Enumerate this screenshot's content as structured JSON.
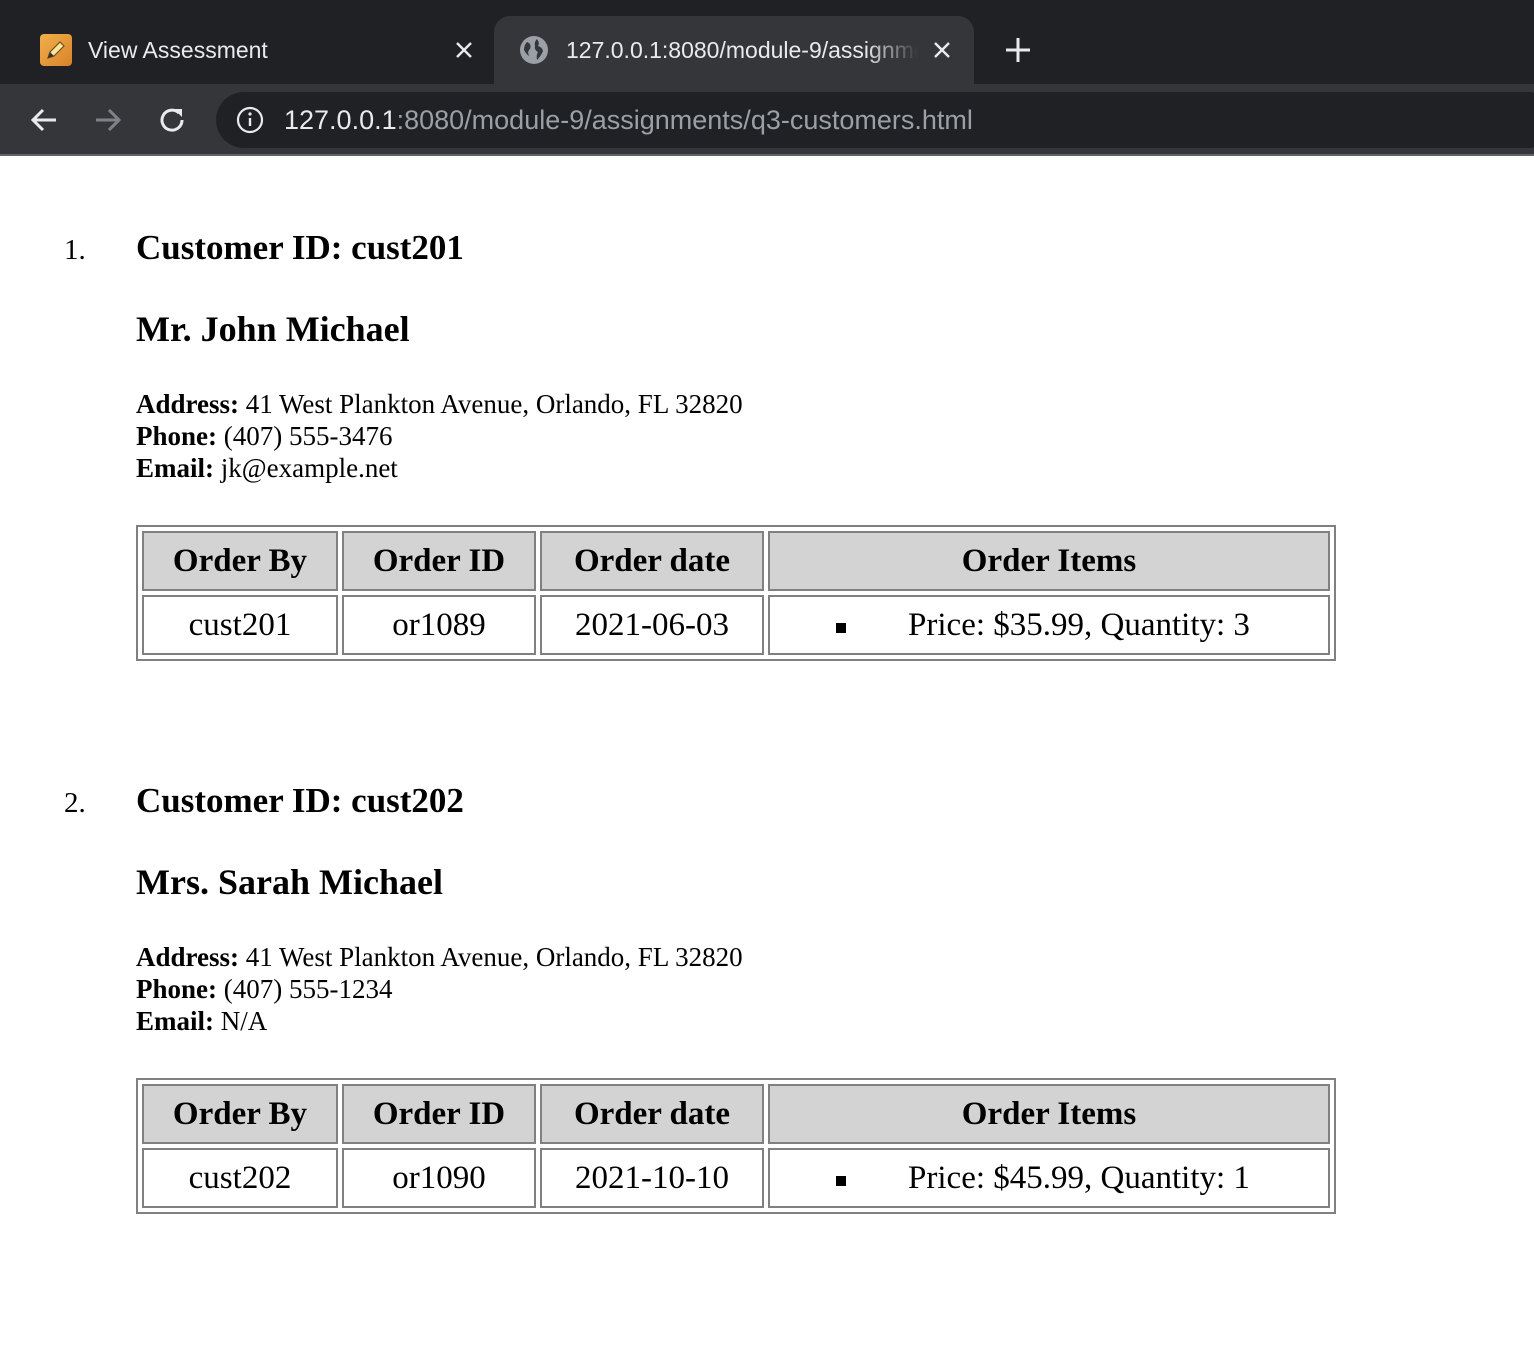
{
  "browser": {
    "tabs": [
      {
        "title": "View Assessment",
        "active": false,
        "icon": "pencil-icon"
      },
      {
        "title": "127.0.0.1:8080/module-9/assignments/q3-customers.html",
        "active": true,
        "icon": "globe-icon"
      }
    ],
    "url_host": "127.0.0.1",
    "url_rest": ":8080/module-9/assignments/q3-customers.html"
  },
  "labels": {
    "customer_id_prefix": "Customer ID: ",
    "address": "Address:",
    "phone": "Phone:",
    "email": "Email:",
    "col_order_by": "Order By",
    "col_order_id": "Order ID",
    "col_order_date": "Order date",
    "col_order_items": "Order Items"
  },
  "customers": [
    {
      "number": "1.",
      "customer_id": "Customer ID: cust201",
      "name": "Mr. John Michael",
      "address": "41 West Plankton Avenue, Orlando, FL 32820",
      "phone": "(407) 555-3476",
      "email": "jk@example.net",
      "order": {
        "order_by": "cust201",
        "order_id": "or1089",
        "order_date": "2021-06-03",
        "items": [
          "Price: $35.99, Quantity: 3"
        ]
      }
    },
    {
      "number": "2.",
      "customer_id": "Customer ID: cust202",
      "name": "Mrs. Sarah Michael",
      "address": "41 West Plankton Avenue, Orlando, FL 32820",
      "phone": "(407) 555-1234",
      "email": "N/A",
      "order": {
        "order_by": "cust202",
        "order_id": "or1090",
        "order_date": "2021-10-10",
        "items": [
          "Price: $45.99, Quantity: 1"
        ]
      }
    }
  ],
  "colors": {
    "tabstrip": "#202124",
    "toolbar": "#35363a",
    "table_header_bg": "#d3d3d3",
    "table_border": "#808080"
  }
}
